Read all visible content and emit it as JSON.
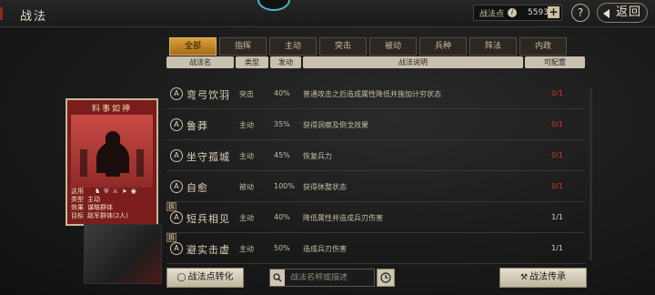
{
  "header": {
    "title": "战法",
    "points_label": "战法点",
    "points_value": "5593",
    "back_label": "返回"
  },
  "tabs": [
    {
      "label": "全部",
      "active": true
    },
    {
      "label": "指挥"
    },
    {
      "label": "主动"
    },
    {
      "label": "突击"
    },
    {
      "label": "被动"
    },
    {
      "label": "兵种"
    },
    {
      "label": "阵法"
    },
    {
      "label": "内政"
    }
  ],
  "columns": [
    "战法名",
    "类型",
    "发动",
    "战法说明",
    "可配置"
  ],
  "tactics": [
    {
      "icon": "A",
      "name": "弯弓饮羽",
      "type": "突击",
      "rate": "40%",
      "desc": "普通攻击之后造成属性降低并施加计穷状态",
      "config": "0/1",
      "config_color": "red"
    },
    {
      "icon": "A",
      "name": "鲁莽",
      "type": "主动",
      "rate": "35%",
      "desc": "获得洞察及倒戈效果",
      "config": "0/1",
      "config_color": "red"
    },
    {
      "icon": "A",
      "name": "坐守孤城",
      "type": "主动",
      "rate": "45%",
      "desc": "恢复兵力",
      "config": "0/1",
      "config_color": "red"
    },
    {
      "icon": "A",
      "name": "自愈",
      "type": "被动",
      "rate": "100%",
      "desc": "获得休整状态",
      "config": "0/1",
      "config_color": "red"
    },
    {
      "icon": "A",
      "name": "短兵相见",
      "type": "主动",
      "rate": "40%",
      "desc": "降低属性并造成兵刃伤害",
      "config": "1/1",
      "config_color": "white",
      "tag": "拆"
    },
    {
      "icon": "A",
      "name": "避实击虚",
      "type": "主动",
      "rate": "50%",
      "desc": "造成兵刃伤害",
      "config": "1/1",
      "config_color": "white",
      "tag": "拆"
    }
  ],
  "card": {
    "title": "料事如神",
    "info": [
      {
        "k": "这用",
        "v": ""
      },
      {
        "k": "类型",
        "v": "主动"
      },
      {
        "k": "效果",
        "v": "谋略群体"
      },
      {
        "k": "目标",
        "v": "敌军群体(2人)"
      }
    ]
  },
  "footer": {
    "convert_label": "战法点转化",
    "search_placeholder": "战法名称或描述",
    "inherit_label": "战法传承"
  },
  "colors": {
    "accent_tab": "#d8a03c",
    "red_text": "#d43a2a",
    "card_red": "#7a1d1c"
  }
}
